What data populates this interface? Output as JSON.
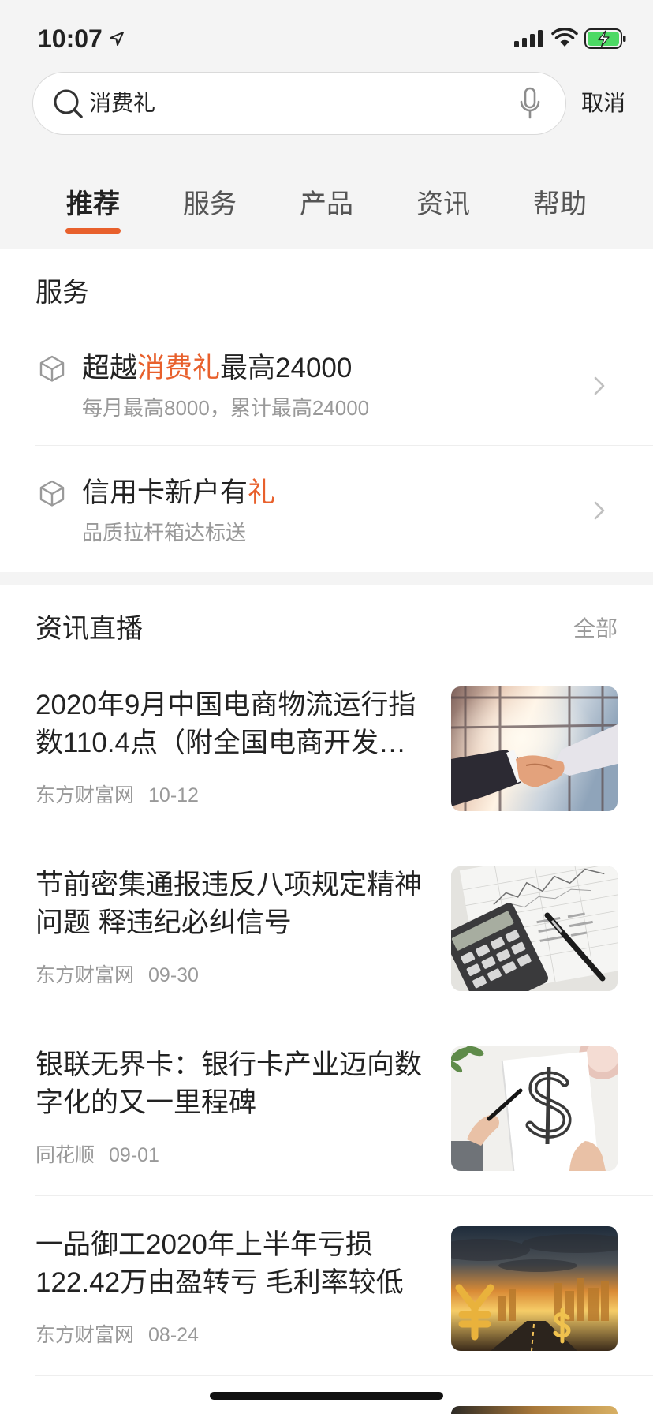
{
  "status_bar": {
    "time": "10:07",
    "icons": [
      "location-arrow-icon",
      "signal-icon",
      "wifi-icon",
      "battery-charging-icon"
    ]
  },
  "search": {
    "query": "消费礼",
    "cancel_label": "取消",
    "icons": [
      "search-icon",
      "microphone-icon"
    ]
  },
  "tabs": [
    {
      "label": "推荐",
      "active": true
    },
    {
      "label": "服务",
      "active": false
    },
    {
      "label": "产品",
      "active": false
    },
    {
      "label": "资讯",
      "active": false
    },
    {
      "label": "帮助",
      "active": false
    }
  ],
  "services": {
    "heading": "服务",
    "items": [
      {
        "icon": "cube-icon",
        "title_before": "超越",
        "title_highlight": "消费礼",
        "title_after": "最高24000",
        "subtitle": "每月最高8000，累计最高24000"
      },
      {
        "icon": "cube-icon",
        "title_before": "信用卡新户有",
        "title_highlight": "礼",
        "subtitle": "品质拉杆箱达标送"
      }
    ]
  },
  "news": {
    "heading": "资讯直播",
    "all_label": "全部",
    "items": [
      {
        "title_lines": [
          "2020年9月中国电商物流运行指",
          "数110.4点（附全国电商开发…"
        ],
        "source": "东方财富网",
        "date": "10-12",
        "thumbnail": "handshake-photo"
      },
      {
        "title_lines": [
          "节前密集通报违反八项规定精神",
          "问题 释违纪必纠信号"
        ],
        "source": "东方财富网",
        "date": "09-30",
        "thumbnail": "calculator-chart-photo"
      },
      {
        "title_lines": [
          "银联无界卡：银行卡产业迈向数",
          "字化的又一里程碑"
        ],
        "source": "同花顺",
        "date": "09-01",
        "thumbnail": "dollar-sketch-photo"
      },
      {
        "title_lines": [
          "一品御工2020年上半年亏损",
          "122.42万由盈转亏 毛利率较低"
        ],
        "source": "东方财富网",
        "date": "08-24",
        "thumbnail": "golden-currency-city-photo"
      },
      {
        "thumbnail": "partial-photo"
      }
    ]
  },
  "colors": {
    "accent": "#e8602c",
    "text": "#222222",
    "muted": "#999999",
    "background": "#f4f4f4",
    "card": "#ffffff",
    "divider": "#eeeeee",
    "battery": "#4cd964"
  }
}
